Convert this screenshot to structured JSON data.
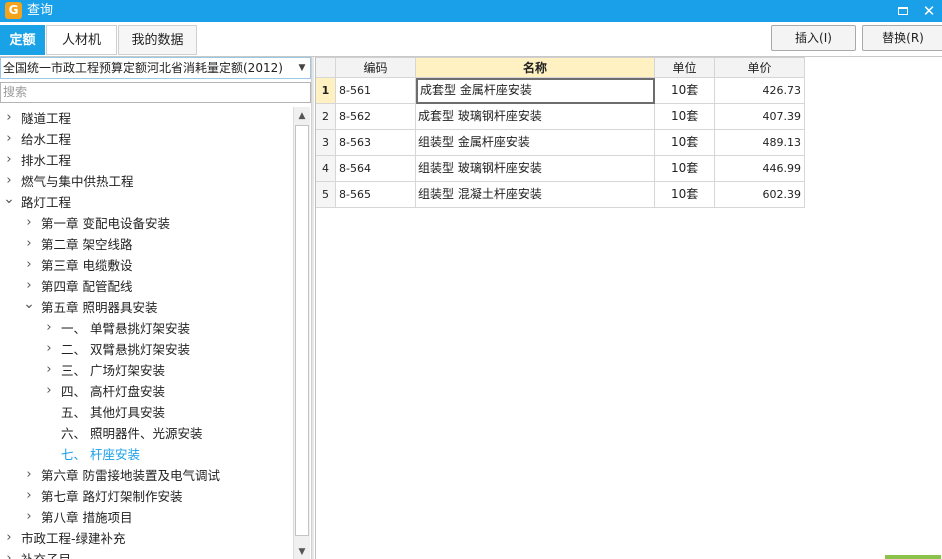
{
  "window": {
    "title": "查询",
    "icon_glyph": "G"
  },
  "tabs": [
    {
      "label": "定额",
      "active": true
    },
    {
      "label": "人材机",
      "active": false
    },
    {
      "label": "我的数据",
      "active": false
    }
  ],
  "toolbar": {
    "insert_label": "插入(I)",
    "replace_label": "替换(R)"
  },
  "quota_selector": {
    "value": "全国统一市政工程预算定额河北省消耗量定额(2012)"
  },
  "search": {
    "placeholder": "搜索"
  },
  "tree": [
    {
      "label": "隧道工程",
      "level": 0,
      "state": "collapsed"
    },
    {
      "label": "给水工程",
      "level": 0,
      "state": "collapsed"
    },
    {
      "label": "排水工程",
      "level": 0,
      "state": "collapsed"
    },
    {
      "label": "燃气与集中供热工程",
      "level": 0,
      "state": "collapsed"
    },
    {
      "label": "路灯工程",
      "level": 0,
      "state": "expanded"
    },
    {
      "label": "第一章  变配电设备安装",
      "level": 1,
      "state": "collapsed"
    },
    {
      "label": "第二章  架空线路",
      "level": 1,
      "state": "collapsed"
    },
    {
      "label": "第三章  电缆敷设",
      "level": 1,
      "state": "collapsed"
    },
    {
      "label": "第四章  配管配线",
      "level": 1,
      "state": "collapsed"
    },
    {
      "label": "第五章  照明器具安装",
      "level": 1,
      "state": "expanded"
    },
    {
      "label": "一、  单臂悬挑灯架安装",
      "level": 2,
      "state": "collapsed"
    },
    {
      "label": "二、  双臂悬挑灯架安装",
      "level": 2,
      "state": "collapsed"
    },
    {
      "label": "三、  广场灯架安装",
      "level": 2,
      "state": "collapsed"
    },
    {
      "label": "四、  高杆灯盘安装",
      "level": 2,
      "state": "collapsed"
    },
    {
      "label": "五、  其他灯具安装",
      "level": 2,
      "state": "leaf"
    },
    {
      "label": "六、  照明器件、光源安装",
      "level": 2,
      "state": "leaf"
    },
    {
      "label": "七、  杆座安装",
      "level": 2,
      "state": "leaf",
      "selected": true
    },
    {
      "label": "第六章  防雷接地装置及电气调试",
      "level": 1,
      "state": "collapsed"
    },
    {
      "label": "第七章  路灯灯架制作安装",
      "level": 1,
      "state": "collapsed"
    },
    {
      "label": "第八章  措施项目",
      "level": 1,
      "state": "collapsed"
    },
    {
      "label": "市政工程-绿建补充",
      "level": 0,
      "state": "collapsed"
    },
    {
      "label": "补充子目",
      "level": 0,
      "state": "collapsed"
    }
  ],
  "grid": {
    "columns": [
      "",
      "编码",
      "名称",
      "单位",
      "单价"
    ],
    "rows": [
      {
        "num": "1",
        "code": "8-561",
        "name": "成套型 金属杆座安装",
        "unit": "10套",
        "price": "426.73"
      },
      {
        "num": "2",
        "code": "8-562",
        "name": "成套型 玻璃钢杆座安装",
        "unit": "10套",
        "price": "407.39"
      },
      {
        "num": "3",
        "code": "8-563",
        "name": "组装型 金属杆座安装",
        "unit": "10套",
        "price": "489.13"
      },
      {
        "num": "4",
        "code": "8-564",
        "name": "组装型 玻璃钢杆座安装",
        "unit": "10套",
        "price": "446.99"
      },
      {
        "num": "5",
        "code": "8-565",
        "name": "组装型 混凝土杆座安装",
        "unit": "10套",
        "price": "602.39"
      }
    ],
    "current_row": 0
  },
  "colors": {
    "accent": "#1aa0e8",
    "header_highlight": "#fff1c2",
    "selected_text": "#1aa0e8"
  }
}
